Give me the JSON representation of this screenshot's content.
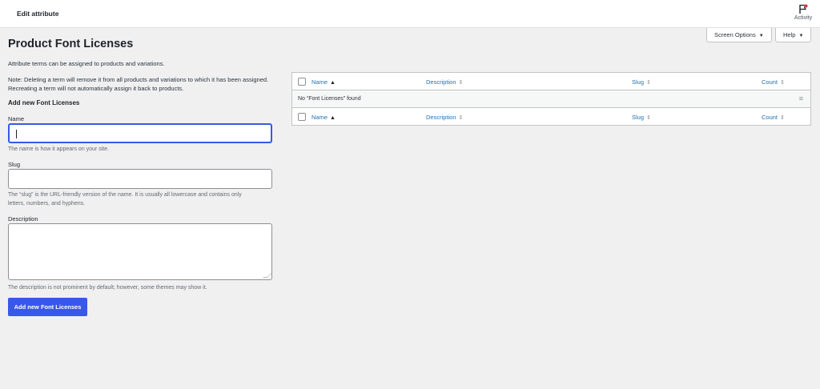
{
  "topbar": {
    "title": "Edit attribute",
    "activity_label": "Activity"
  },
  "buttons": {
    "screen_options": "Screen Options",
    "help": "Help",
    "caret": "▼"
  },
  "page": {
    "title": "Product Font Licenses",
    "intro": "Attribute terms can be assigned to products and variations.",
    "note_line1": "Note: Deleting a term will remove it from all products and variations to which it has been assigned.",
    "note_line2": "Recreating a term will not automatically assign it back to products."
  },
  "form": {
    "heading": "Add new Font Licenses",
    "name_label": "Name",
    "name_value": "",
    "name_desc": "The name is how it appears on your site.",
    "slug_label": "Slug",
    "slug_value": "",
    "slug_desc_line1": "The “slug” is the URL-friendly version of the name. It is usually all lowercase and contains only",
    "slug_desc_line2": "letters, numbers, and hyphens.",
    "description_label": "Description",
    "description_value": "",
    "description_desc": "The description is not prominent by default; however, some themes may show it.",
    "submit_label": "Add new Font Licenses"
  },
  "table": {
    "columns": [
      {
        "label": "Name",
        "sort": "▲"
      },
      {
        "label": "Description",
        "sort": "⇕"
      },
      {
        "label": "Slug",
        "sort": "⇕"
      },
      {
        "label": "Count",
        "sort": "⇕"
      }
    ],
    "empty_message": "No “Font Licenses” found",
    "row_menu_icon": "≡"
  },
  "colors": {
    "accent": "#3858e9",
    "link": "#2271b1",
    "background": "#f0f0f1"
  }
}
